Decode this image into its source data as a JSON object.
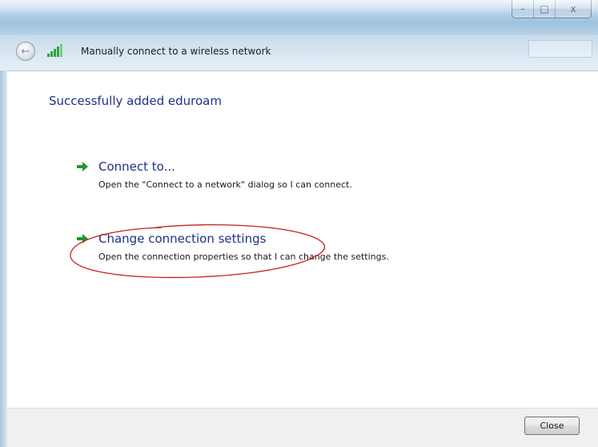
{
  "window": {
    "title": "Manually connect to a wireless network",
    "controls": {
      "minimize_icon": "minimize-icon",
      "maximize_icon": "maximize-icon",
      "close_icon": "close-icon",
      "minimize_glyph": "–",
      "maximize_glyph": "□",
      "close_glyph": "x"
    },
    "icons": {
      "back": "back-arrow-icon",
      "signal": "wireless-signal-icon"
    },
    "back_glyph": "←"
  },
  "main": {
    "heading": "Successfully added eduroam",
    "options": [
      {
        "title": "Connect to...",
        "description": "Open the \"Connect to a network\" dialog so I can connect.",
        "icon": "green-arrow-icon"
      },
      {
        "title": "Change connection settings",
        "description": "Open the connection properties so that I can change the settings.",
        "icon": "green-arrow-icon"
      }
    ],
    "annotation": "red-ellipse-highlight"
  },
  "footer": {
    "close_label": "Close"
  },
  "colors": {
    "heading_blue": "#1e3287",
    "arrow_green": "#1f9a2e",
    "annotation_red": "#c81e1e",
    "titlebar": "#b8d3e9",
    "footer_bg": "#f0f0f0"
  }
}
